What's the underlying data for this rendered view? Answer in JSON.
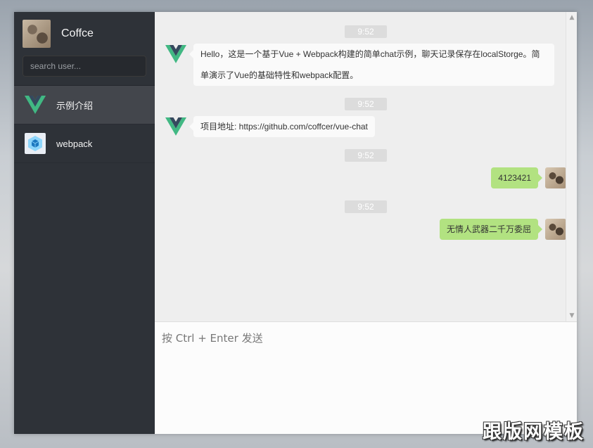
{
  "user": {
    "name": "Coffce",
    "avatar_icon": "user-photo-avatar"
  },
  "search": {
    "placeholder": "search user..."
  },
  "sessions": [
    {
      "name": "示例介绍",
      "icon": "vue-logo-icon",
      "active": true
    },
    {
      "name": "webpack",
      "icon": "webpack-logo-icon",
      "active": false
    }
  ],
  "messages": [
    {
      "time": "9:52",
      "text": "Hello，这是一个基于Vue + Webpack构建的简单chat示例，聊天记录保存在localStorge。简单演示了Vue的基础特性和webpack配置。",
      "self": false
    },
    {
      "time": "9:52",
      "text": "项目地址: https://github.com/coffcer/vue-chat",
      "self": false
    },
    {
      "time": "9:52",
      "text": "4123421",
      "self": true
    },
    {
      "time": "9:52",
      "text": "无情人武器二千万委屈",
      "self": true
    }
  ],
  "input": {
    "placeholder": "按 Ctrl + Enter 发送",
    "value": ""
  },
  "watermark": "跟版网模板",
  "colors": {
    "sidebar": "#2e3238",
    "self_bubble": "#b2e281",
    "vue_green": "#41b883",
    "vue_dark": "#35495e"
  }
}
